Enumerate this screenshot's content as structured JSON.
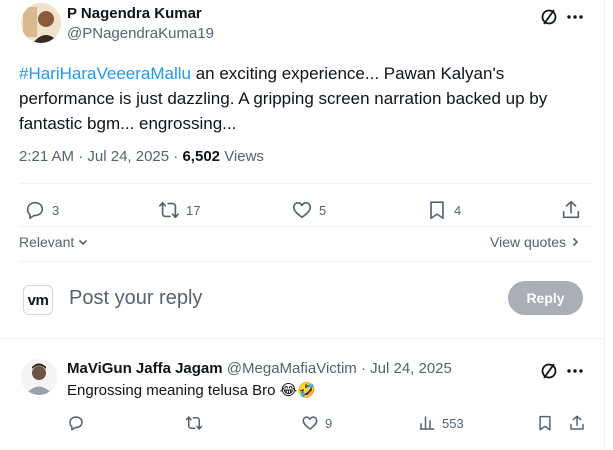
{
  "main_post": {
    "author_name": "P Nagendra Kumar",
    "author_handle": "@PNagendraKuma19",
    "hashtag": "#HariHaraVeeeraMallu",
    "text_line1_rest": " an exciting experience... Pawan Kalyan's",
    "text_line2": "performance is just dazzling. A gripping screen narration backed up by",
    "text_line3": "fantastic bgm... engrossing...",
    "time": "2:21 AM",
    "sep": "·",
    "date": "Jul 24, 2025",
    "views_count": "6,502",
    "views_label": "Views",
    "actions": {
      "replies": "3",
      "reposts": "17",
      "likes": "5",
      "bookmarks": "4"
    }
  },
  "sort": {
    "label": "Relevant",
    "view_quotes": "View quotes"
  },
  "composer": {
    "avatar_text": "vm",
    "placeholder": "Post your reply",
    "reply_button": "Reply"
  },
  "reply_post": {
    "author_name": "MaViGun Jaffa Jagam",
    "author_handle": "@MegaMafiaVictim",
    "sep": "·",
    "date": "Jul 24, 2025",
    "text": "Engrossing meaning telusa Bro 😂🤣",
    "actions": {
      "replies": "",
      "reposts": "",
      "likes": "9",
      "views": "553"
    }
  },
  "colors": {
    "accent": "#1d9bf0",
    "muted": "#536471",
    "divider": "#eff3f4",
    "reply_disabled": "#a9afb4"
  }
}
